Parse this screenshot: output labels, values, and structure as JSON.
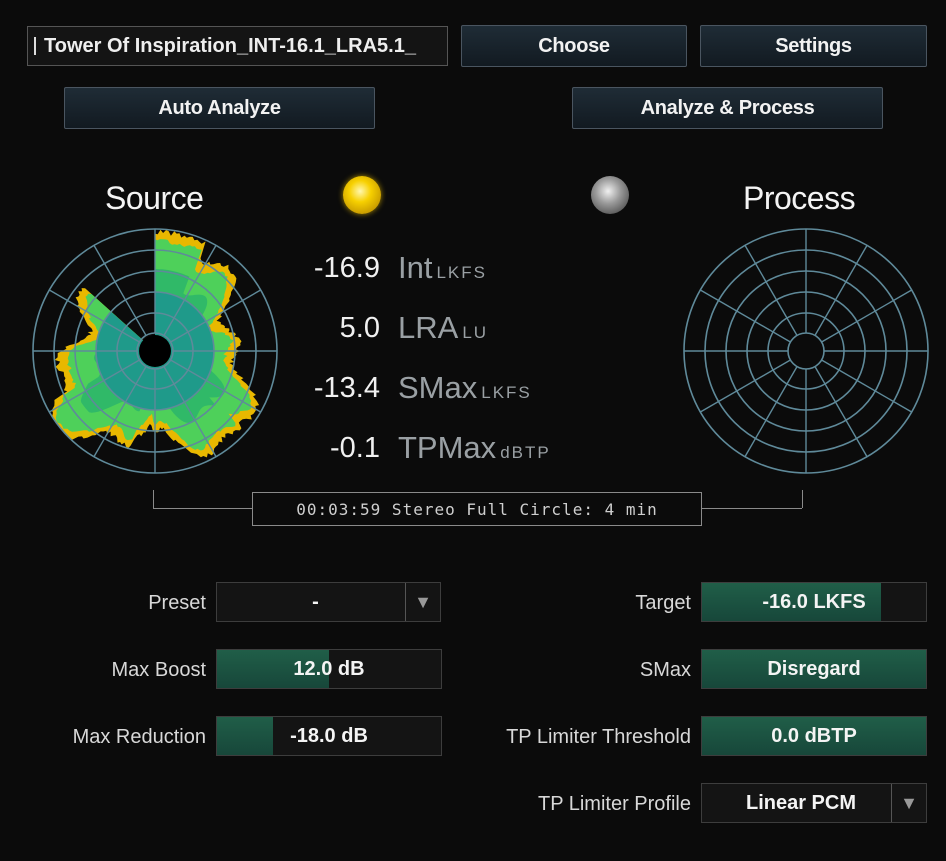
{
  "file": {
    "name": "Tower Of Inspiration_INT-16.1_LRA5.1_"
  },
  "buttons": {
    "choose": "Choose",
    "settings": "Settings",
    "auto_analyze": "Auto Analyze",
    "analyze_process": "Analyze & Process"
  },
  "source": {
    "title": "Source",
    "lamp_color": "#f5c400",
    "lamp_state": "on"
  },
  "process": {
    "title": "Process",
    "lamp_color": "#9a9a9a",
    "lamp_state": "off"
  },
  "measurements": [
    {
      "value": "-16.9",
      "name": "Int",
      "unit": "LKFS"
    },
    {
      "value": "5.0",
      "name": "LRA",
      "unit": "LU"
    },
    {
      "value": "-13.4",
      "name": "SMax",
      "unit": "LKFS"
    },
    {
      "value": "-0.1",
      "name": "TPMax",
      "unit": "dBTP"
    }
  ],
  "status": {
    "text": "00:03:59 Stereo  Full Circle: 4 min"
  },
  "controls": {
    "preset": {
      "label": "Preset",
      "value": "-"
    },
    "max_boost": {
      "label": "Max Boost",
      "value": "12.0 dB",
      "fill_fraction": 0.5
    },
    "max_reduction": {
      "label": "Max Reduction",
      "value": "-18.0 dB",
      "fill_fraction": 0.25
    },
    "target": {
      "label": "Target",
      "value": "-16.0 LKFS",
      "fill_fraction": 0.8
    },
    "smax": {
      "label": "SMax",
      "value": "Disregard",
      "fill_fraction": 1.0
    },
    "tp_threshold": {
      "label": "TP Limiter Threshold",
      "value": "0.0 dBTP",
      "fill_fraction": 1.0
    },
    "tp_profile": {
      "label": "TP Limiter Profile",
      "value": "Linear PCM"
    }
  },
  "colors": {
    "accent_green": "#1e5a45",
    "radar_grid": "#5f8a9a",
    "radar_loud": "#4ed05a",
    "radar_inner": "#1f9a8a",
    "radar_peak": "#e8b800"
  }
}
